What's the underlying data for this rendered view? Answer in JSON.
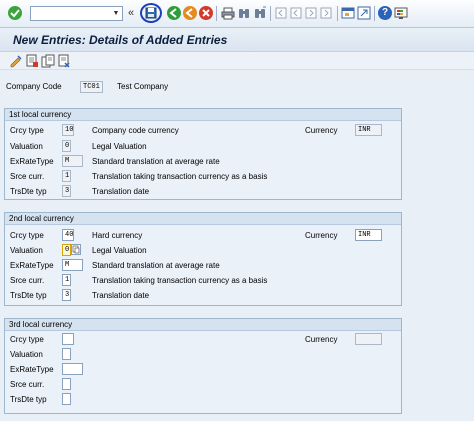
{
  "toolbar": {
    "command_field_value": "",
    "icons": [
      "enter-icon",
      "save-icon",
      "back-icon",
      "exit-icon",
      "cancel-icon",
      "print-icon",
      "find-icon",
      "find-next-icon",
      "first-page-icon",
      "previous-page-icon",
      "next-page-icon",
      "last-page-icon",
      "new-session-icon",
      "shortcut-icon",
      "help-icon",
      "customize-layout-icon"
    ]
  },
  "page": {
    "title": "New Entries: Details of Added Entries"
  },
  "company": {
    "label": "Company Code",
    "code": "TC01",
    "name": "Test Company"
  },
  "groups": [
    {
      "title": "1st local currency",
      "currency_label": "Currency",
      "currency_value": "INR",
      "rows": [
        {
          "label": "Crcy type",
          "value": "10",
          "desc": "Company code currency"
        },
        {
          "label": "Valuation",
          "value": "0",
          "desc": "Legal Valuation"
        },
        {
          "label": "ExRateType",
          "value": "M",
          "desc": "Standard translation at average rate"
        },
        {
          "label": "Srce curr.",
          "value": "1",
          "desc": "Translation taking transaction currency as a basis"
        },
        {
          "label": "TrsDte typ",
          "value": "3",
          "desc": "Translation date"
        }
      ]
    },
    {
      "title": "2nd local currency",
      "currency_label": "Currency",
      "currency_value": "INR",
      "rows": [
        {
          "label": "Crcy type",
          "value": "40",
          "desc": "Hard currency"
        },
        {
          "label": "Valuation",
          "value": "0",
          "desc": "Legal Valuation"
        },
        {
          "label": "ExRateType",
          "value": "M",
          "desc": "Standard translation at average rate"
        },
        {
          "label": "Srce curr.",
          "value": "1",
          "desc": "Translation taking transaction currency as a basis"
        },
        {
          "label": "TrsDte typ",
          "value": "3",
          "desc": "Translation date"
        }
      ]
    },
    {
      "title": "3rd local currency",
      "currency_label": "Currency",
      "currency_value": "",
      "rows": [
        {
          "label": "Crcy type",
          "value": "",
          "desc": ""
        },
        {
          "label": "Valuation",
          "value": "",
          "desc": ""
        },
        {
          "label": "ExRateType",
          "value": "",
          "desc": ""
        },
        {
          "label": "Srce curr.",
          "value": "",
          "desc": ""
        },
        {
          "label": "TrsDte typ",
          "value": "",
          "desc": ""
        }
      ]
    }
  ],
  "colors": {
    "save_highlight": "#1f3fb8",
    "valuation_focus": "#d9a400"
  }
}
